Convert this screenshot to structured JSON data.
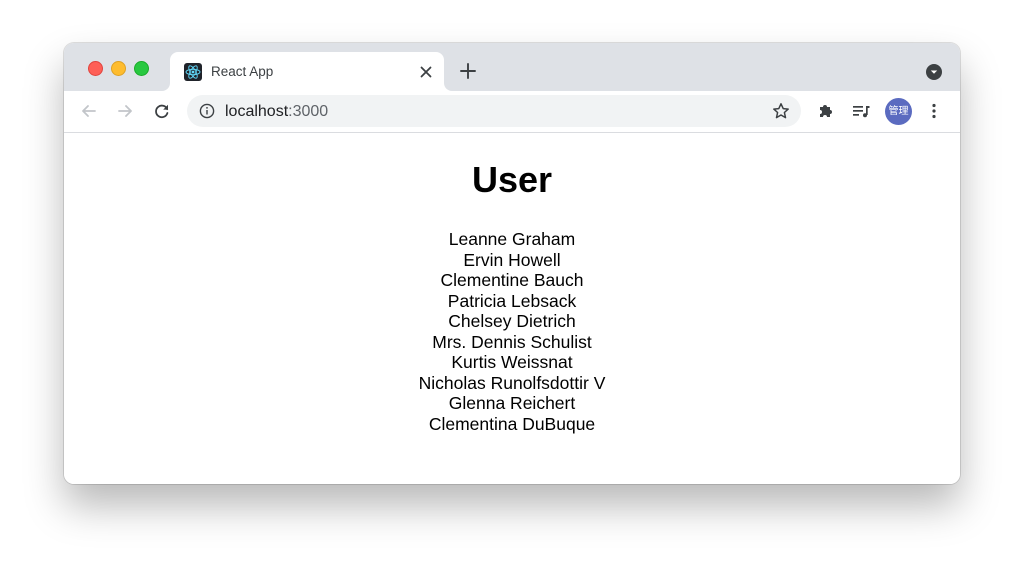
{
  "browser": {
    "tab": {
      "title": "React App",
      "favicon": "react-logo-icon"
    },
    "address_bar": {
      "host": "localhost",
      "port": ":3000"
    },
    "profile_avatar_label": "管理",
    "colors": {
      "tabstrip": "#dee1e6",
      "omnibox": "#f1f3f4",
      "avatar": "#5b6bc0",
      "react_logo": "#61dafb"
    }
  },
  "page": {
    "title": "User",
    "users": [
      "Leanne Graham",
      "Ervin Howell",
      "Clementine Bauch",
      "Patricia Lebsack",
      "Chelsey Dietrich",
      "Mrs. Dennis Schulist",
      "Kurtis Weissnat",
      "Nicholas Runolfsdottir V",
      "Glenna Reichert",
      "Clementina DuBuque"
    ]
  }
}
